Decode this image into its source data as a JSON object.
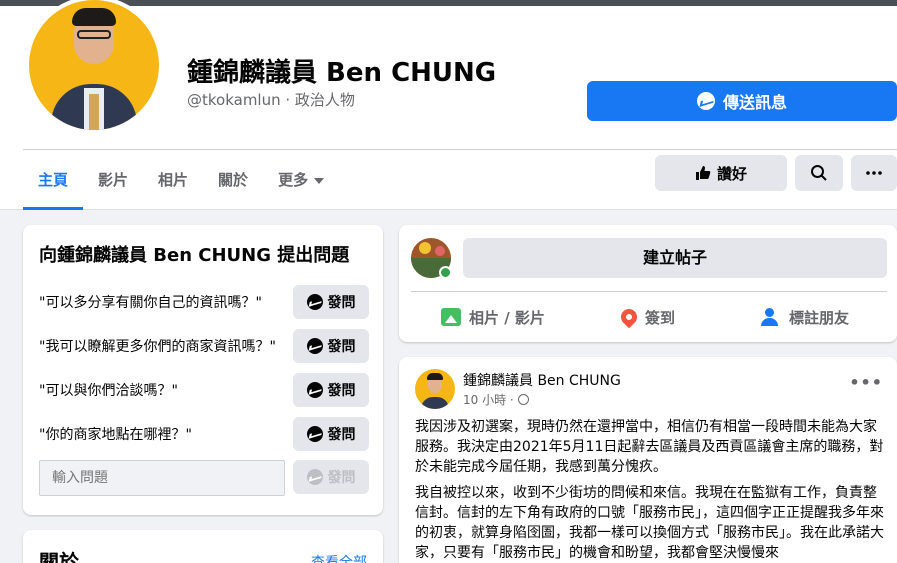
{
  "page": {
    "name": "鍾錦麟議員 Ben CHUNG",
    "handle": "@tkokamlun · 政治人物",
    "send_message": "傳送訊息"
  },
  "tabs": [
    {
      "label": "主頁",
      "active": true
    },
    {
      "label": "影片"
    },
    {
      "label": "相片"
    },
    {
      "label": "關於"
    },
    {
      "label": "更多"
    }
  ],
  "actions": {
    "like_label": "讚好"
  },
  "ask": {
    "title": "向鍾錦麟議員 Ben CHUNG 提出問題",
    "questions": [
      "\"可以多分享有關你自己的資訊嗎？\"",
      "\"我可以瞭解更多你們的商家資訊嗎？\"",
      "\"可以與你們洽談嗎？\"",
      "\"你的商家地點在哪裡？\""
    ],
    "button_label": "發問",
    "input_placeholder": "輸入問題"
  },
  "about": {
    "title": "關於",
    "see_all": "查看全部"
  },
  "composer": {
    "create_post": "建立帖子",
    "photo_video": "相片 / 影片",
    "check_in": "簽到",
    "tag_friends": "標註朋友"
  },
  "post": {
    "author": "鍾錦麟議員 Ben CHUNG",
    "time": "10 小時 ·",
    "paragraph1": "我因涉及初選案，現時仍然在還押當中，相信仍有相當一段時間未能為大家服務。我決定由2021年5月11日起辭去區議員及西貢區議會主席的職務，對於未能完成今屆任期，我感到萬分愧疚。",
    "paragraph2": "我自被控以來，收到不少街坊的問候和來信。我現在在監獄有工作，負責整信封。信封的左下角有政府的口號「服務市民」，這四個字正正提醒我多年來的初衷，就算身陷囹圄，我都一樣可以換個方式「服務市民」。我在此承諾大家，只要有「服務市民」的機會和盼望，我都會堅決慢慢來"
  },
  "colors": {
    "primary": "#1877f2",
    "background": "#f0f2f5",
    "button_gray": "#e4e6eb"
  }
}
